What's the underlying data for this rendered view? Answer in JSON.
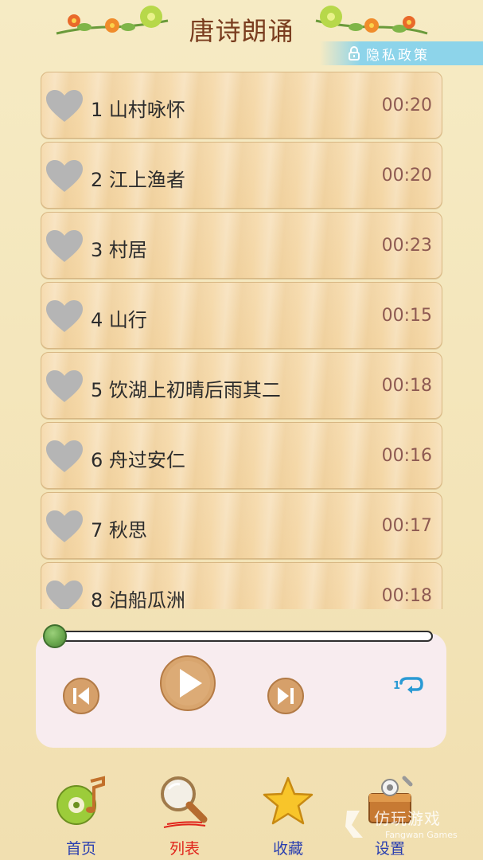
{
  "app": {
    "title": "唐诗朗诵",
    "privacy_label": "隐私政策"
  },
  "poems": [
    {
      "title": "1 山村咏怀",
      "duration": "00:20"
    },
    {
      "title": "2 江上渔者",
      "duration": "00:20"
    },
    {
      "title": "3 村居",
      "duration": "00:23"
    },
    {
      "title": "4 山行",
      "duration": "00:15"
    },
    {
      "title": "5 饮湖上初晴后雨其二",
      "duration": "00:18"
    },
    {
      "title": "6 舟过安仁",
      "duration": "00:16"
    },
    {
      "title": "7 秋思",
      "duration": "00:17"
    },
    {
      "title": "8 泊船瓜洲",
      "duration": "00:18"
    }
  ],
  "player": {
    "progress": 0.0,
    "repeat_badge": "1"
  },
  "nav": [
    {
      "label": "首页",
      "color": "#2a3fb0",
      "icon": "music-disc-icon"
    },
    {
      "label": "列表",
      "color": "#e0241b",
      "icon": "magnifier-icon"
    },
    {
      "label": "收藏",
      "color": "#2a3fb0",
      "icon": "star-icon"
    },
    {
      "label": "设置",
      "color": "#2a3fb0",
      "icon": "settings-toolbox-icon"
    }
  ],
  "watermark": {
    "main": "仿玩游戏",
    "sub": "Fangwan Games"
  },
  "colors": {
    "title": "#7a3d1f",
    "row_bg": "#f5d9a9",
    "duration": "#8e5a52",
    "heart": "#b5b5b5",
    "privacy_bg": "#8dd4ea",
    "player_bg": "#f8ecef"
  }
}
